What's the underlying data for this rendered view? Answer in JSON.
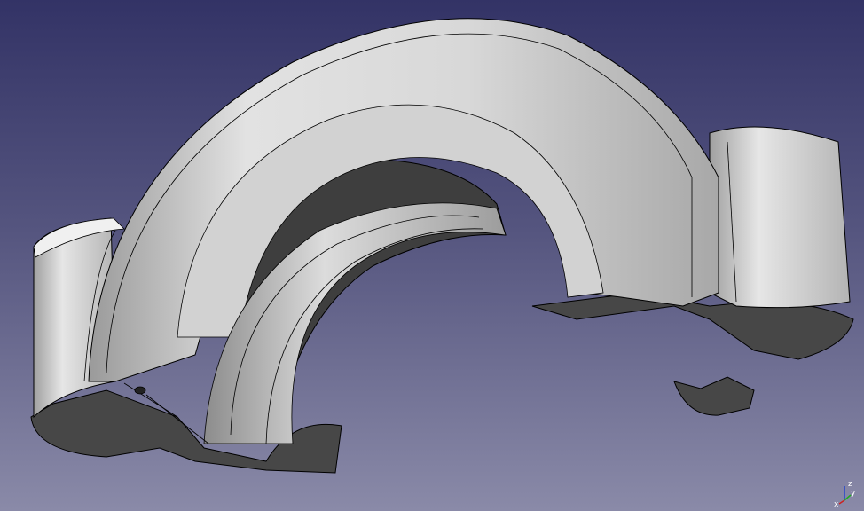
{
  "viewer": {
    "background_top": "#333366",
    "background_bottom": "#8a8aa8"
  },
  "model": {
    "face_color": "#d6d6d6",
    "shadow_color": "#4a4a4a",
    "edge_color": "#000000"
  },
  "axes": {
    "x_label": "x",
    "y_label": "y",
    "z_label": "z",
    "x_color": "#cc2222",
    "y_color": "#22aa22",
    "z_color": "#2244cc"
  }
}
